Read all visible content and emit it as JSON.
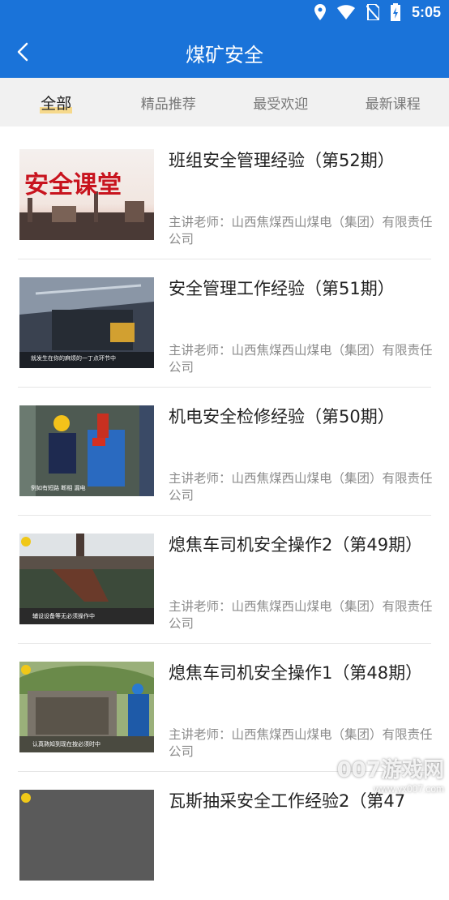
{
  "status": {
    "time": "5:05"
  },
  "header": {
    "title": "煤矿安全",
    "back_icon": "chevron-left-icon"
  },
  "tabs": [
    {
      "label": "全部",
      "active": true
    },
    {
      "label": "精品推荐",
      "active": false
    },
    {
      "label": "最受欢迎",
      "active": false
    },
    {
      "label": "最新课程",
      "active": false
    }
  ],
  "courses": [
    {
      "title": "班组安全管理经验（第52期）",
      "teacher": "主讲老师：山西焦煤西山煤电（集团）有限责任公司",
      "thumb_caption": "安全课堂"
    },
    {
      "title": "安全管理工作经验（第51期）",
      "teacher": "主讲老师：山西焦煤西山煤电（集团）有限责任公司",
      "thumb_caption": "就发生在你的麻烦的一丁点环节中"
    },
    {
      "title": "机电安全检修经验（第50期）",
      "teacher": "主讲老师：山西焦煤西山煤电（集团）有限责任公司",
      "thumb_caption": "例如有短路 断相 漏电"
    },
    {
      "title": "熄焦车司机安全操作2（第49期）",
      "teacher": "主讲老师：山西焦煤西山煤电（集团）有限责任公司",
      "thumb_caption": "辅设设备等无必须操作中"
    },
    {
      "title": "熄焦车司机安全操作1（第48期）",
      "teacher": "主讲老师：山西焦煤西山煤电（集团）有限责任公司",
      "thumb_caption": "认真熟知到现在按必须时中"
    },
    {
      "title": "瓦斯抽采安全工作经验2（第47",
      "teacher": "",
      "thumb_caption": ""
    }
  ],
  "watermark": {
    "main": "007游戏网",
    "url": "www.yx007.com"
  },
  "colors": {
    "primary": "#1a73d9",
    "tab_bg": "#f1f1f1",
    "tab_highlight": "#f6d98c"
  }
}
